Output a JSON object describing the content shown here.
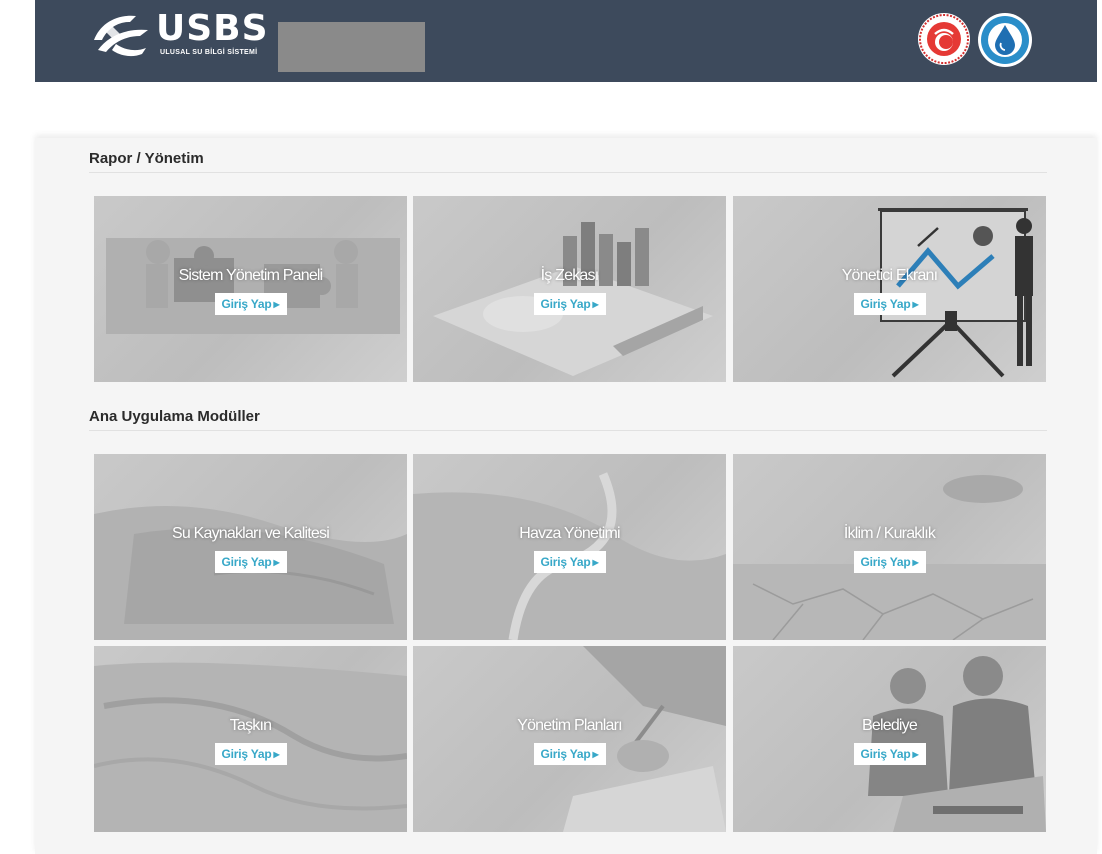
{
  "header": {
    "logo_title": "USBS",
    "logo_subtitle": "ULUSAL SU BİLGİ SİSTEMİ"
  },
  "sections": [
    {
      "title": "Rapor / Yönetim",
      "tiles": [
        {
          "label": "Sistem Yönetim Paneli",
          "button": "Giriş Yap"
        },
        {
          "label": "İş Zekası",
          "button": "Giriş Yap"
        },
        {
          "label": "Yönetici Ekranı",
          "button": "Giriş Yap"
        }
      ]
    },
    {
      "title": "Ana Uygulama Modüller",
      "tiles": [
        {
          "label": "Su Kaynakları ve Kalitesi",
          "button": "Giriş Yap"
        },
        {
          "label": "Havza Yönetimi",
          "button": "Giriş Yap"
        },
        {
          "label": "İklim / Kuraklık",
          "button": "Giriş Yap"
        },
        {
          "label": "Taşkın",
          "button": "Giriş Yap"
        },
        {
          "label": "Yönetim Planları",
          "button": "Giriş Yap"
        },
        {
          "label": "Belediye",
          "button": "Giriş Yap"
        }
      ]
    }
  ],
  "colors": {
    "header_bg": "#3d4a5c",
    "panel_bg": "#f5f5f5",
    "button_text": "#38a8c8",
    "tile_bg": "#c6c6c6"
  },
  "icons": {
    "logo": "usbs-swoosh-icon",
    "seal_ministry": "ministry-seal-icon",
    "seal_water": "water-drop-seal-icon",
    "button_arrow": "caret-right-icon"
  }
}
